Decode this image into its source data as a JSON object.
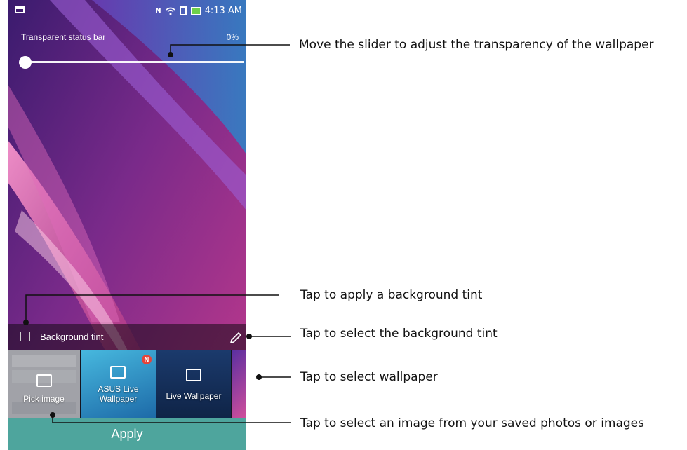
{
  "status_bar": {
    "nfc": "N",
    "time": "4:13 AM"
  },
  "transparency": {
    "label": "Transparent status bar",
    "value": "0%",
    "slider_level": 0
  },
  "tint": {
    "label": "Background tint",
    "checked": false
  },
  "wallpapers": [
    {
      "label": "Pick image"
    },
    {
      "label": "ASUS Live Wallpaper",
      "badge": "N"
    },
    {
      "label": "Live Wallpaper"
    }
  ],
  "apply_label": "Apply",
  "callouts": {
    "slider": "Move the slider to adjust the transparency of the wallpaper",
    "tint_apply": "Tap to apply a background tint",
    "tint_select": "Tap to select the background tint",
    "wallpaper_select": "Tap to select wallpaper",
    "image_select": "Tap to select an image from your saved photos or images"
  },
  "colors": {
    "apply_button": "#4ea59d",
    "battery": "#6fd04a",
    "badge": "#e6443a"
  },
  "icons": [
    "wifi-icon",
    "sim-icon",
    "battery-icon",
    "pencil-icon",
    "image-icon",
    "live-wallpaper-icon"
  ]
}
